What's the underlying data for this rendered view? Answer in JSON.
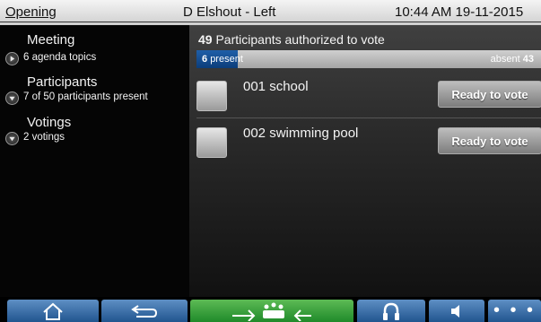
{
  "status_bar": {
    "section": "Opening",
    "seat": "D Elshout - Left",
    "datetime": "10:44 AM 19-11-2015"
  },
  "sidebar": {
    "items": [
      {
        "title": "Meeting",
        "subtitle": "6 agenda topics",
        "indicator": "play-right-icon"
      },
      {
        "title": "Participants",
        "subtitle": "7 of 50 participants present",
        "indicator": "chevron-down-icon"
      },
      {
        "title": "Votings",
        "subtitle": "2 votings",
        "indicator": "chevron-down-icon"
      }
    ]
  },
  "main": {
    "authorized_count": "49",
    "authorized_text": "Participants authorized to vote",
    "progress": {
      "present_count": "6",
      "present_label": "present",
      "absent_label": "absent",
      "absent_count": "43",
      "present_fraction": 0.12
    },
    "votings": [
      {
        "label": "001  school",
        "button": "Ready to vote"
      },
      {
        "label": "002  swimming pool",
        "button": "Ready to vote"
      }
    ]
  },
  "bottom_bar": {
    "buttons": [
      {
        "icon": "home-icon"
      },
      {
        "icon": "back-arrow-icon"
      },
      {
        "icon": "transfer-participants-icon"
      },
      {
        "icon": "headphones-icon"
      },
      {
        "icon": "speaker-icon"
      },
      {
        "icon": "more-icon",
        "label": "• • •"
      }
    ]
  },
  "colors": {
    "nav_blue": "#3a6fa8",
    "nav_green": "#3aa83f",
    "progress_blue": "#1b5499"
  }
}
